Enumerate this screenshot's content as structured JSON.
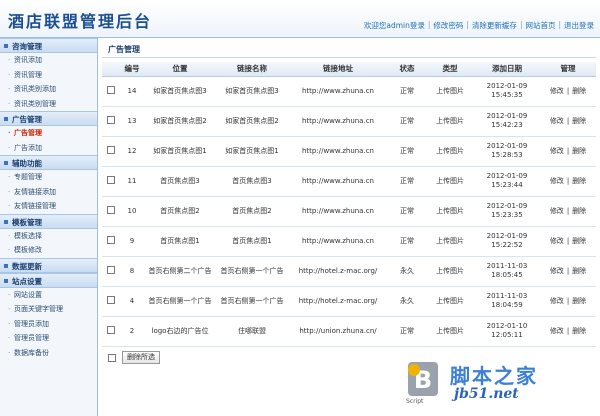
{
  "header": {
    "title": "酒店联盟管理后台",
    "links": [
      "欢迎您admin登录",
      "修改密码",
      "清除更新缓存",
      "网站首页",
      "退出登录"
    ]
  },
  "sidebar": {
    "sections": [
      {
        "title": "咨询管理",
        "items": [
          "资讯添加",
          "资讯管理",
          "资讯类别添加",
          "资讯类别管理"
        ]
      },
      {
        "title": "广告管理",
        "items": [
          "广告管理",
          "广告添加"
        ],
        "active": "广告管理"
      },
      {
        "title": "辅助功能",
        "items": [
          "专题管理",
          "友情链接添加",
          "友情链接管理"
        ]
      },
      {
        "title": "模板管理",
        "items": [
          "模板选择",
          "模板修改"
        ]
      },
      {
        "title": "数据更新",
        "items": []
      },
      {
        "title": "站点设置",
        "items": [
          "网站设置",
          "页面关键字管理",
          "管理员添加",
          "管理员管理",
          "数据库备份"
        ]
      }
    ]
  },
  "main": {
    "panel_title": "广告管理",
    "columns": [
      "编号",
      "位置",
      "链接名称",
      "链接地址",
      "状态",
      "类型",
      "添加日期",
      "管理"
    ],
    "rows": [
      {
        "id": "14",
        "position": "如家首页焦点图3",
        "name": "如家首页焦点图3",
        "url": "http://www.zhuna.cn",
        "status": "正常",
        "type": "上传图片",
        "date": "2012-01-09",
        "time": "15:45:35"
      },
      {
        "id": "13",
        "position": "如家首页焦点图2",
        "name": "如家首页焦点图2",
        "url": "http://www.zhuna.cn",
        "status": "正常",
        "type": "上传图片",
        "date": "2012-01-09",
        "time": "15:42:23"
      },
      {
        "id": "12",
        "position": "如家首页焦点图1",
        "name": "如家首页焦点图1",
        "url": "http://www.zhuna.cn",
        "status": "正常",
        "type": "上传图片",
        "date": "2012-01-09",
        "time": "15:28:53"
      },
      {
        "id": "11",
        "position": "首页焦点图3",
        "name": "首页焦点图3",
        "url": "http://www.zhuna.cn",
        "status": "正常",
        "type": "上传图片",
        "date": "2012-01-09",
        "time": "15:23:44"
      },
      {
        "id": "10",
        "position": "首页焦点图2",
        "name": "首页焦点图2",
        "url": "http://www.zhuna.cn",
        "status": "正常",
        "type": "上传图片",
        "date": "2012-01-09",
        "time": "15:23:35"
      },
      {
        "id": "9",
        "position": "首页焦点图1",
        "name": "首页焦点图1",
        "url": "http://www.zhuna.cn",
        "status": "正常",
        "type": "上传图片",
        "date": "2012-01-09",
        "time": "15:22:52"
      },
      {
        "id": "8",
        "position": "首页右侧第二个广告",
        "name": "首页右侧第一个广告",
        "url": "http://hotel.z-mac.org/",
        "status": "永久",
        "type": "上传图片",
        "date": "2011-11-03",
        "time": "18:05:45"
      },
      {
        "id": "4",
        "position": "首页右侧第一个广告",
        "name": "首页右侧第一个广告",
        "url": "http://hotel.z-mac.org/",
        "status": "永久",
        "type": "上传图片",
        "date": "2011-11-03",
        "time": "18:04:59"
      },
      {
        "id": "2",
        "position": "logo右边的广告位",
        "name": "住哪联盟",
        "url": "http://union.zhuna.cn/",
        "status": "正常",
        "type": "上传图片",
        "date": "2012-01-10",
        "time": "12:05:11"
      }
    ],
    "ops": {
      "edit": "修改",
      "delete": "删除"
    },
    "delete_selected": "删除所选"
  },
  "watermark": {
    "brand": "脚本之家",
    "domain": "jb51.net",
    "script_label": "Script"
  }
}
